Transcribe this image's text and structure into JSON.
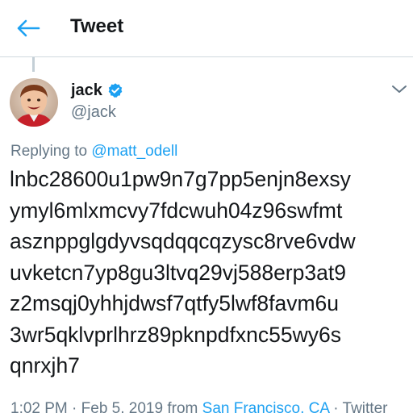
{
  "header": {
    "title": "Tweet",
    "back_icon": "back-arrow-icon"
  },
  "colors": {
    "accent": "#1da1f2",
    "secondary_text": "#657786",
    "primary_text": "#14171a",
    "divider": "#cfd9de"
  },
  "author": {
    "display_name": "jack",
    "handle": "@jack",
    "verified_icon": "verified-badge-icon",
    "more_icon": "chevron-down-icon"
  },
  "reply": {
    "prefix": "Replying to ",
    "mention": "@matt_odell"
  },
  "tweet": {
    "lines": [
      "lnbc28600u1pw9n7g7pp5enjn8exsy",
      "ymyl6mlxmcvy7fdcwuh04z96swfmt",
      "asznppglgdyvsqdqqcqzysc8rve6vdw",
      "uvketcn7yp8gu3ltvq29vj588erp3at9",
      "z2msqj0yhhjdwsf7qtfy5lwf8favm6u",
      "3wr5qklvprlhrz89pknpdfxnc55wy6s",
      "qnrxjh7"
    ]
  },
  "meta": {
    "time": "1:02 PM",
    "sep1": " · ",
    "date": "Feb 5, 2019",
    "from": " from ",
    "location": "San Francisco, CA",
    "sep2": " · ",
    "source": "Twitter"
  }
}
